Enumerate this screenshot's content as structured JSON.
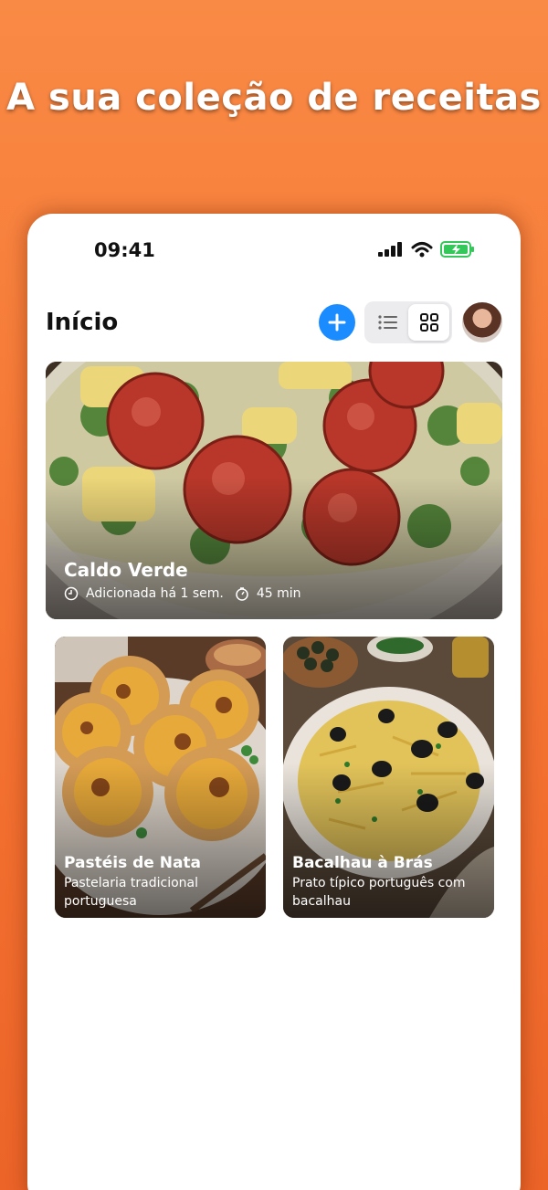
{
  "headline": "A sua coleção de receitas",
  "status_bar": {
    "time": "09:41"
  },
  "nav": {
    "title": "Início"
  },
  "recipes": [
    {
      "title": "Caldo Verde",
      "added": "Adicionada há 1 sem.",
      "duration": "45 min"
    },
    {
      "title": "Pastéis de Nata",
      "subtitle": "Pastelaria tradicional portuguesa"
    },
    {
      "title": "Bacalhau à Brás",
      "subtitle": "Prato típico português com bacalhau"
    }
  ],
  "colors": {
    "accent": "#1a8cff",
    "background": "#f57634",
    "battery": "#34c759"
  },
  "icons": [
    "signal-icon",
    "wifi-icon",
    "battery-icon",
    "plus-icon",
    "list-view-icon",
    "grid-view-icon",
    "clock-icon",
    "timer-icon"
  ]
}
